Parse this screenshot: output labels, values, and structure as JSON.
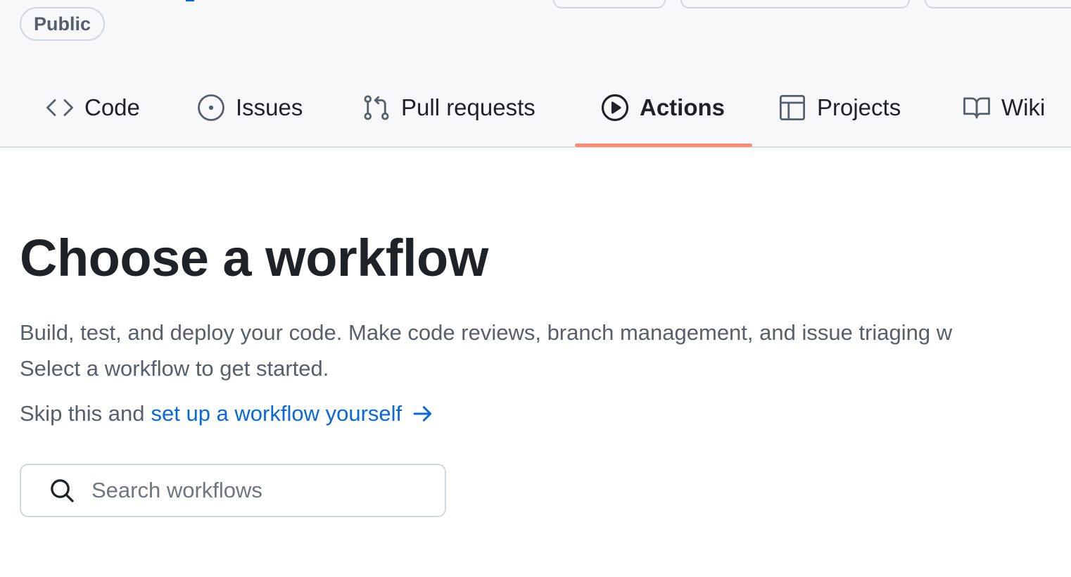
{
  "repo": {
    "visibility_badge": "Public"
  },
  "nav": {
    "tabs": [
      {
        "label": "Code",
        "icon": "code-icon",
        "selected": false
      },
      {
        "label": "Issues",
        "icon": "issue-opened-icon",
        "selected": false
      },
      {
        "label": "Pull requests",
        "icon": "git-pull-request-icon",
        "selected": false
      },
      {
        "label": "Actions",
        "icon": "play-icon",
        "selected": true
      },
      {
        "label": "Projects",
        "icon": "table-icon",
        "selected": false
      },
      {
        "label": "Wiki",
        "icon": "book-icon",
        "selected": false
      }
    ]
  },
  "main": {
    "title": "Choose a workflow",
    "description_line1": "Build, test, and deploy your code. Make code reviews, branch management, and issue triaging w",
    "description_line2": "Select a workflow to get started.",
    "skip_prefix": "Skip this and",
    "skip_link": "set up a workflow yourself",
    "skip_icon": "arrow-right-icon",
    "search": {
      "placeholder": "Search workflows",
      "value": "",
      "icon": "search-icon"
    }
  },
  "colors": {
    "accent_link": "#0969da",
    "selected_tab_underline": "#fd8c73",
    "header_background": "#f6f8fa",
    "text_primary": "#1f2328",
    "text_muted": "#57606a"
  }
}
